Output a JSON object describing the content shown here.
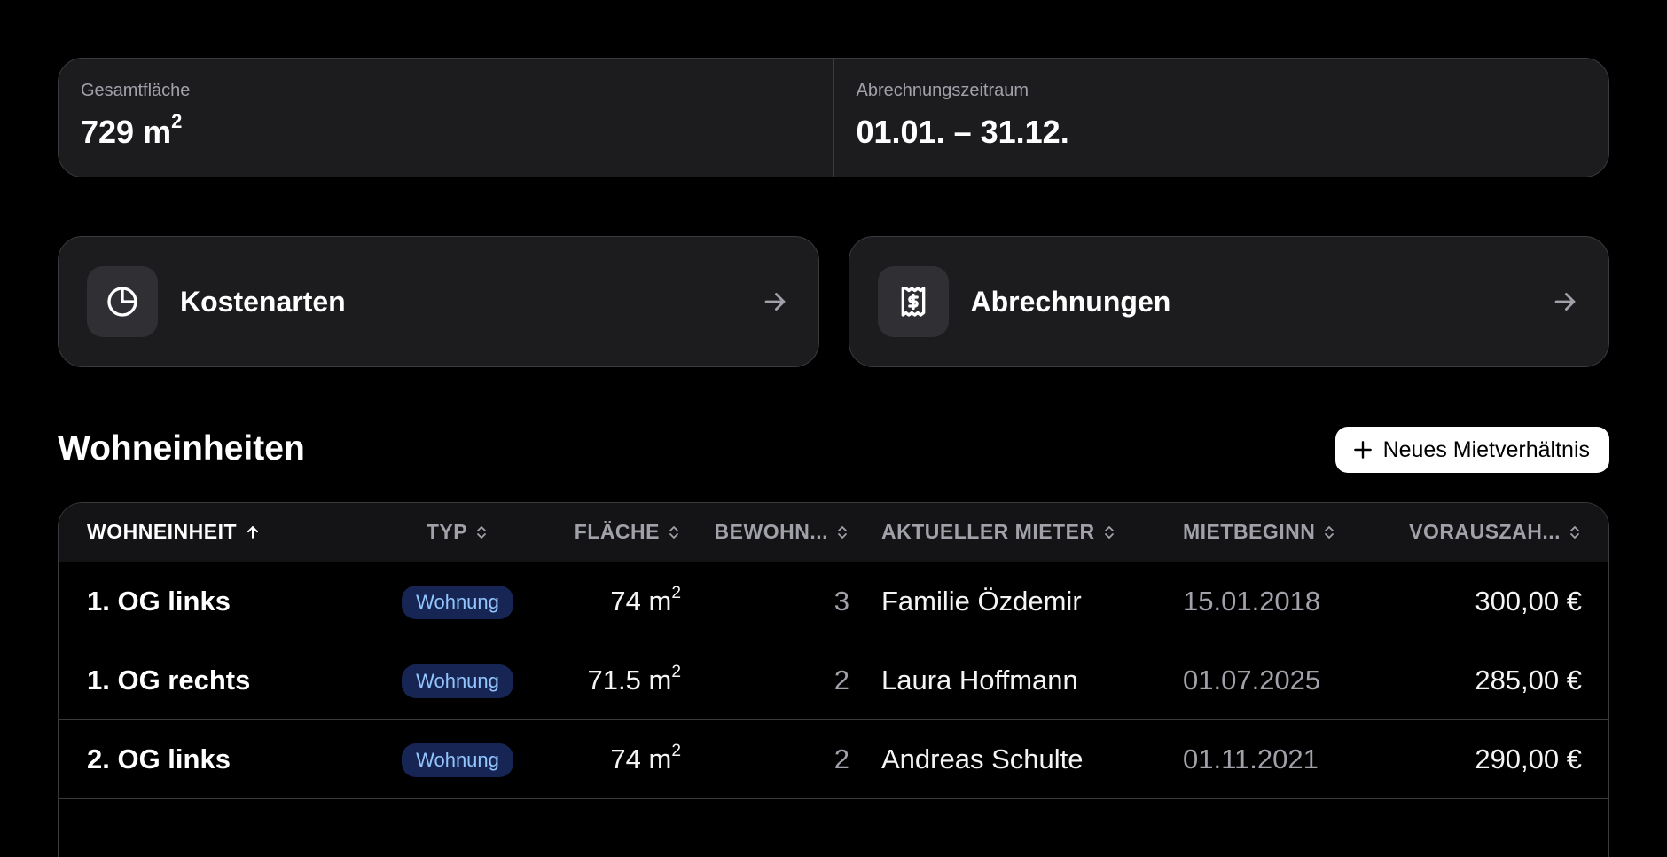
{
  "stats": [
    {
      "label": "Gesamtfläche",
      "value": "729 m",
      "unit_sup": "2"
    },
    {
      "label": "Abrechnungszeitraum",
      "value": "01.01. – 31.12."
    }
  ],
  "cards": [
    {
      "title": "Kostenarten",
      "icon": "pie-chart-icon"
    },
    {
      "title": "Abrechnungen",
      "icon": "receipt-dollar-icon"
    }
  ],
  "section": {
    "title": "Wohneinheiten",
    "add_button": "Neues Mietverhältnis"
  },
  "table": {
    "headers": [
      "Wohneinheit",
      "Typ",
      "Fläche",
      "Bewohn...",
      "Aktueller Mieter",
      "Mietbeginn",
      "Vorauszah..."
    ],
    "sort": {
      "column": "Wohneinheit",
      "direction": "asc"
    },
    "rows": [
      {
        "unit": "1. OG links",
        "type": "Wohnung",
        "area": "74 m",
        "area_sup": "2",
        "residents": "3",
        "tenant": "Familie Özdemir",
        "start": "15.01.2018",
        "prepay": "300,00 €"
      },
      {
        "unit": "1. OG rechts",
        "type": "Wohnung",
        "area": "71.5 m",
        "area_sup": "2",
        "residents": "2",
        "tenant": "Laura Hoffmann",
        "start": "01.07.2025",
        "prepay": "285,00 €"
      },
      {
        "unit": "2. OG links",
        "type": "Wohnung",
        "area": "74 m",
        "area_sup": "2",
        "residents": "2",
        "tenant": "Andreas Schulte",
        "start": "01.11.2021",
        "prepay": "290,00 €"
      }
    ]
  },
  "colors": {
    "background": "#000000",
    "panel": "#1c1c1f",
    "border": "#3a3a3f",
    "badge_bg": "#172554",
    "badge_text": "#93c5fd"
  }
}
